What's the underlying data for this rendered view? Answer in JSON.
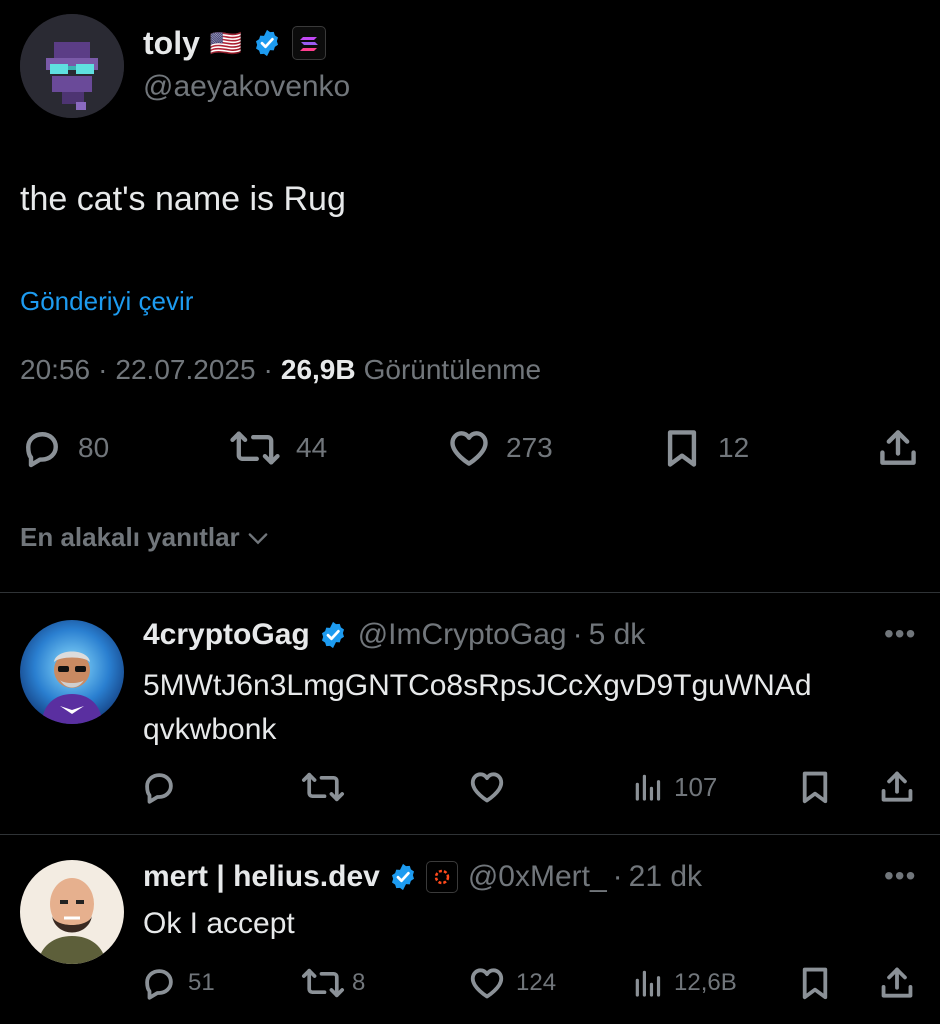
{
  "post": {
    "display_name": "toly",
    "flag": "🇺🇸",
    "handle": "@aeyakovenko",
    "text": "the cat's name is Rug",
    "translate_link": "Gönderiyi çevir",
    "time": "20:56",
    "date": "22.07.2025",
    "views_count": "26,9B",
    "views_label": "Görüntülenme",
    "actions": {
      "replies": "80",
      "reposts": "44",
      "likes": "273",
      "bookmarks": "12"
    }
  },
  "sort_label": "En alakalı yanıtlar",
  "replies": [
    {
      "display_name": "4cryptoGag",
      "handle": "@ImCryptoGag",
      "age": "5 dk",
      "text": "5MWtJ6n3LmgGNTCo8sRpsJCcXgvD9TguWNAd qvkwbonk",
      "views": "107"
    },
    {
      "display_name": "mert | helius.dev",
      "handle": "@0xMert_",
      "age": "21 dk",
      "text": "Ok I accept",
      "replies": "51",
      "reposts": "8",
      "likes": "124",
      "views": "12,6B"
    }
  ],
  "icons": {
    "reply": "reply-icon",
    "repost": "repost-icon",
    "like": "heart-icon",
    "bookmark": "bookmark-icon",
    "share": "share-icon",
    "views": "views-icon",
    "more": "more-icon",
    "verified": "verified-badge-icon"
  },
  "colors": {
    "accent": "#1d9bf0",
    "background": "#000000",
    "muted": "#71767b"
  }
}
